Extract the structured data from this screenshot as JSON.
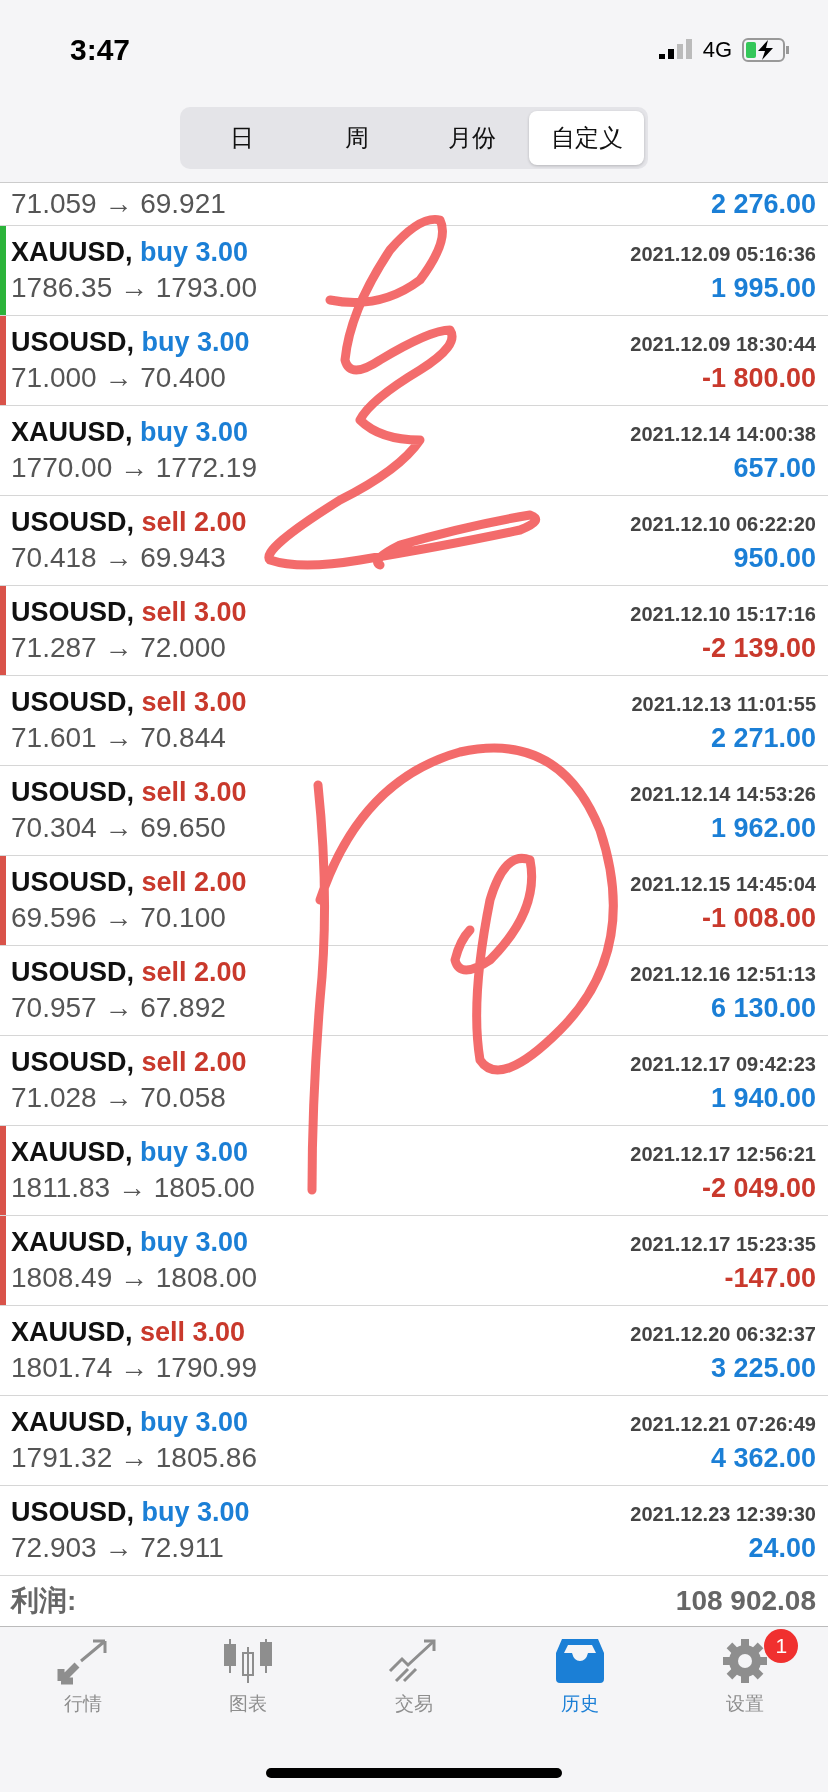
{
  "status_bar": {
    "time": "3:47",
    "network": "4G"
  },
  "tabs": [
    {
      "label": "日",
      "selected": false
    },
    {
      "label": "周",
      "selected": false
    },
    {
      "label": "月份",
      "selected": false
    },
    {
      "label": "自定义",
      "selected": true
    }
  ],
  "partial_row": {
    "prices": "71.059 → 69.921",
    "profit": {
      "text": "2 276.00",
      "color": "#1b7fd6"
    }
  },
  "trades": [
    {
      "symbol": "XAUUSD,",
      "order": {
        "text": "buy 3.00",
        "color": "#1b7fd6"
      },
      "time": "2021.12.09 05:16:36",
      "prices": "1786.35 → 1793.00",
      "profit": {
        "text": "1 995.00",
        "color": "#1b7fd6"
      },
      "bar": {
        "color": "#2bb33a"
      }
    },
    {
      "symbol": "USOUSD,",
      "order": {
        "text": "buy 3.00",
        "color": "#1b7fd6"
      },
      "time": "2021.12.09 18:30:44",
      "prices": "71.000 → 70.400",
      "profit": {
        "text": "-1 800.00",
        "color": "#c9392c"
      },
      "bar": {
        "color": "#d9534a"
      }
    },
    {
      "symbol": "XAUUSD,",
      "order": {
        "text": "buy 3.00",
        "color": "#1b7fd6"
      },
      "time": "2021.12.14 14:00:38",
      "prices": "1770.00 → 1772.19",
      "profit": {
        "text": "657.00",
        "color": "#1b7fd6"
      }
    },
    {
      "symbol": "USOUSD,",
      "order": {
        "text": "sell 2.00",
        "color": "#c9392c"
      },
      "time": "2021.12.10 06:22:20",
      "prices": "70.418 → 69.943",
      "profit": {
        "text": "950.00",
        "color": "#1b7fd6"
      }
    },
    {
      "symbol": "USOUSD,",
      "order": {
        "text": "sell 3.00",
        "color": "#c9392c"
      },
      "time": "2021.12.10 15:17:16",
      "prices": "71.287 → 72.000",
      "profit": {
        "text": "-2 139.00",
        "color": "#c9392c"
      },
      "bar": {
        "color": "#d9534a"
      }
    },
    {
      "symbol": "USOUSD,",
      "order": {
        "text": "sell 3.00",
        "color": "#c9392c"
      },
      "time": "2021.12.13 11:01:55",
      "prices": "71.601 → 70.844",
      "profit": {
        "text": "2 271.00",
        "color": "#1b7fd6"
      }
    },
    {
      "symbol": "USOUSD,",
      "order": {
        "text": "sell 3.00",
        "color": "#c9392c"
      },
      "time": "2021.12.14 14:53:26",
      "prices": "70.304 → 69.650",
      "profit": {
        "text": "1 962.00",
        "color": "#1b7fd6"
      }
    },
    {
      "symbol": "USOUSD,",
      "order": {
        "text": "sell 2.00",
        "color": "#c9392c"
      },
      "time": "2021.12.15 14:45:04",
      "prices": "69.596 → 70.100",
      "profit": {
        "text": "-1 008.00",
        "color": "#c9392c"
      },
      "bar": {
        "color": "#d9534a"
      }
    },
    {
      "symbol": "USOUSD,",
      "order": {
        "text": "sell 2.00",
        "color": "#c9392c"
      },
      "time": "2021.12.16 12:51:13",
      "prices": "70.957 → 67.892",
      "profit": {
        "text": "6 130.00",
        "color": "#1b7fd6"
      }
    },
    {
      "symbol": "USOUSD,",
      "order": {
        "text": "sell 2.00",
        "color": "#c9392c"
      },
      "time": "2021.12.17 09:42:23",
      "prices": "71.028 → 70.058",
      "profit": {
        "text": "1 940.00",
        "color": "#1b7fd6"
      }
    },
    {
      "symbol": "XAUUSD,",
      "order": {
        "text": "buy 3.00",
        "color": "#1b7fd6"
      },
      "time": "2021.12.17 12:56:21",
      "prices": "1811.83 → 1805.00",
      "profit": {
        "text": "-2 049.00",
        "color": "#c9392c"
      },
      "bar": {
        "color": "#d9534a"
      }
    },
    {
      "symbol": "XAUUSD,",
      "order": {
        "text": "buy 3.00",
        "color": "#1b7fd6"
      },
      "time": "2021.12.17 15:23:35",
      "prices": "1808.49 → 1808.00",
      "profit": {
        "text": "-147.00",
        "color": "#c9392c"
      },
      "bar": {
        "color": "#d9534a"
      }
    },
    {
      "symbol": "XAUUSD,",
      "order": {
        "text": "sell 3.00",
        "color": "#c9392c"
      },
      "time": "2021.12.20 06:32:37",
      "prices": "1801.74 → 1790.99",
      "profit": {
        "text": "3 225.00",
        "color": "#1b7fd6"
      }
    },
    {
      "symbol": "XAUUSD,",
      "order": {
        "text": "buy 3.00",
        "color": "#1b7fd6"
      },
      "time": "2021.12.21 07:26:49",
      "prices": "1791.32 → 1805.86",
      "profit": {
        "text": "4 362.00",
        "color": "#1b7fd6"
      }
    },
    {
      "symbol": "USOUSD,",
      "order": {
        "text": "buy 3.00",
        "color": "#1b7fd6"
      },
      "time": "2021.12.23 12:39:30",
      "prices": "72.903 → 72.911",
      "profit": {
        "text": "24.00",
        "color": "#1b7fd6"
      }
    }
  ],
  "summary": {
    "label": "利润:",
    "value": "108 902.08"
  },
  "nav": [
    {
      "label": "行情",
      "selected": false
    },
    {
      "label": "图表",
      "selected": false
    },
    {
      "label": "交易",
      "selected": false
    },
    {
      "label": "历史",
      "selected": true
    },
    {
      "label": "设置",
      "selected": false,
      "badge": "1"
    }
  ]
}
